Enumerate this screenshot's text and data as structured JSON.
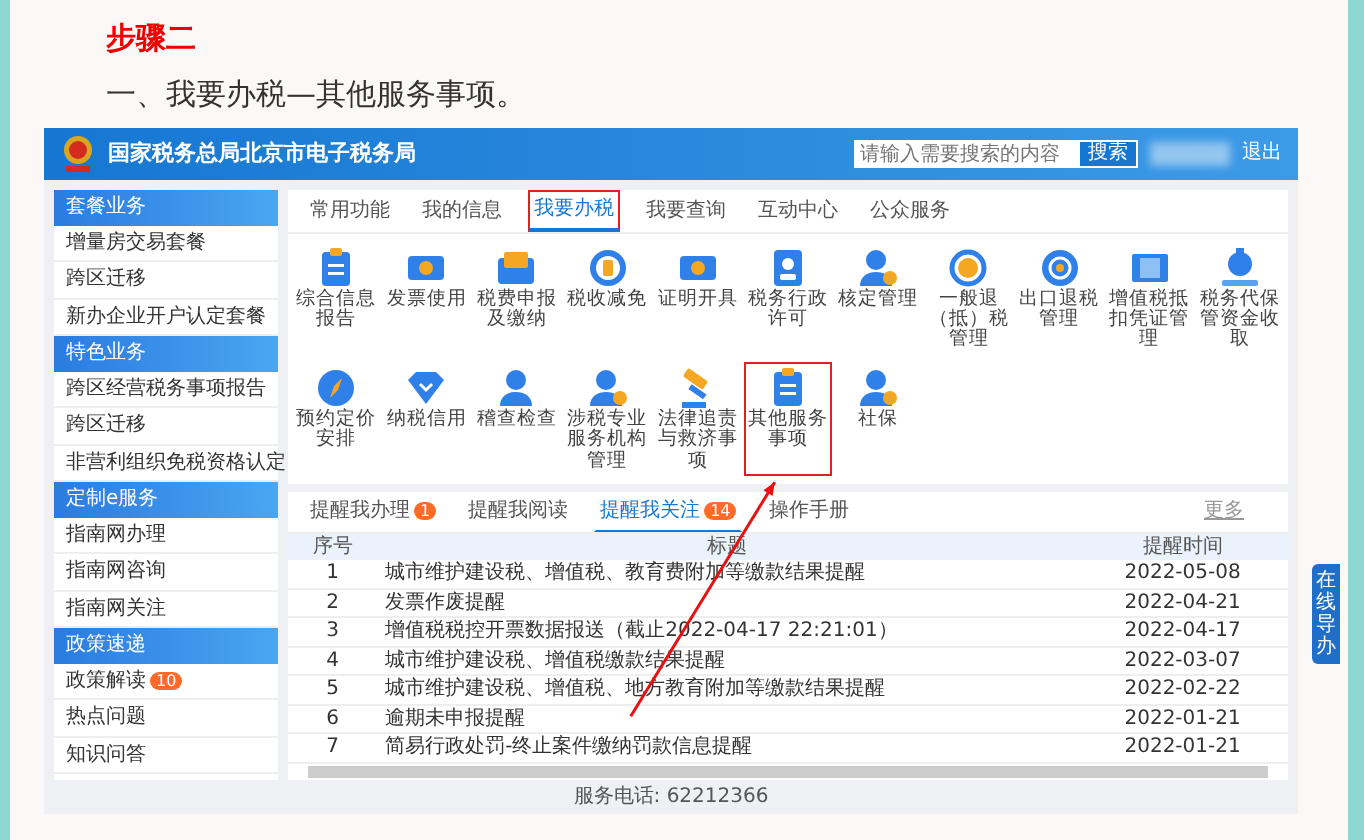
{
  "heading": "步骤二",
  "intro": "一、我要办税—其他服务事项。",
  "portal": {
    "title": "国家税务总局北京市电子税务局",
    "search": {
      "placeholder": "请输入需要搜索的内容",
      "button": "搜索"
    },
    "logout": "退出",
    "sidebar": [
      {
        "title": "套餐业务",
        "items": [
          {
            "label": "增量房交易套餐"
          },
          {
            "label": "跨区迁移"
          },
          {
            "label": "新办企业开户认定套餐"
          }
        ]
      },
      {
        "title": "特色业务",
        "items": [
          {
            "label": "跨区经营税务事项报告"
          },
          {
            "label": "跨区迁移"
          },
          {
            "label": "非营利组织免税资格认定"
          }
        ]
      },
      {
        "title": "定制e服务",
        "items": [
          {
            "label": "指南网办理"
          },
          {
            "label": "指南网咨询"
          },
          {
            "label": "指南网关注"
          }
        ]
      },
      {
        "title": "政策速递",
        "items": [
          {
            "label": "政策解读",
            "badge": "10"
          },
          {
            "label": "热点问题"
          },
          {
            "label": "知识问答"
          }
        ]
      }
    ],
    "tabs": [
      {
        "label": "常用功能",
        "selected": false,
        "highlighted": false
      },
      {
        "label": "我的信息",
        "selected": false,
        "highlighted": false
      },
      {
        "label": "我要办税",
        "selected": true,
        "highlighted": true
      },
      {
        "label": "我要查询",
        "selected": false,
        "highlighted": false
      },
      {
        "label": "互动中心",
        "selected": false,
        "highlighted": false
      },
      {
        "label": "公众服务",
        "selected": false,
        "highlighted": false
      }
    ],
    "services": [
      {
        "label": "综合信息报告",
        "highlighted": false
      },
      {
        "label": "发票使用",
        "highlighted": false
      },
      {
        "label": "税费申报及缴纳",
        "highlighted": false
      },
      {
        "label": "税收减免",
        "highlighted": false
      },
      {
        "label": "证明开具",
        "highlighted": false
      },
      {
        "label": "税务行政许可",
        "highlighted": false
      },
      {
        "label": "核定管理",
        "highlighted": false
      },
      {
        "label": "一般退（抵）税管理",
        "highlighted": false
      },
      {
        "label": "出口退税管理",
        "highlighted": false
      },
      {
        "label": "增值税抵扣凭证管理",
        "highlighted": false
      },
      {
        "label": "税务代保管资金收取",
        "highlighted": false
      },
      {
        "label": "预约定价安排",
        "highlighted": false
      },
      {
        "label": "纳税信用",
        "highlighted": false
      },
      {
        "label": "稽查检查",
        "highlighted": false
      },
      {
        "label": "涉税专业服务机构管理",
        "highlighted": false
      },
      {
        "label": "法律追责与救济事项",
        "highlighted": false
      },
      {
        "label": "其他服务事项",
        "highlighted": true
      },
      {
        "label": "社保",
        "highlighted": false
      }
    ],
    "reminder_tabs": [
      {
        "label": "提醒我办理",
        "badge": "1",
        "selected": false
      },
      {
        "label": "提醒我阅读",
        "selected": false
      },
      {
        "label": "提醒我关注",
        "badge": "14",
        "selected": true
      },
      {
        "label": "操作手册",
        "selected": false
      }
    ],
    "more": "更多",
    "table": {
      "columns": [
        "序号",
        "标题",
        "提醒时间"
      ],
      "rows": [
        [
          "1",
          "城市维护建设税、增值税、教育费附加等缴款结果提醒",
          "2022-05-08"
        ],
        [
          "2",
          "发票作废提醒",
          "2022-04-21"
        ],
        [
          "3",
          "增值税税控开票数据报送（截止2022-04-17 22:21:01）",
          "2022-04-17"
        ],
        [
          "4",
          "城市维护建设税、增值税缴款结果提醒",
          "2022-03-07"
        ],
        [
          "5",
          "城市维护建设税、增值税、地方教育附加等缴款结果提醒",
          "2022-02-22"
        ],
        [
          "6",
          "逾期未申报提醒",
          "2022-01-21"
        ],
        [
          "7",
          "简易行政处罚-终止案件缴纳罚款信息提醒",
          "2022-01-21"
        ]
      ]
    },
    "footer": "服务电话: 62212366",
    "assistant": "在线导办"
  }
}
